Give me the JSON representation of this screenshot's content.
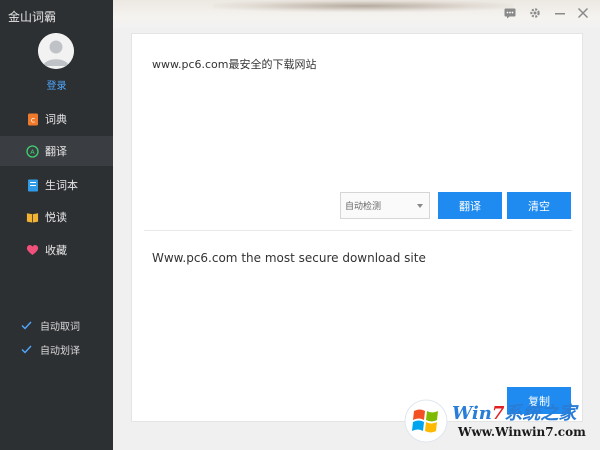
{
  "app": {
    "title": "金山词霸"
  },
  "user": {
    "login_label": "登录"
  },
  "nav": {
    "items": [
      {
        "label": "词典",
        "icon": "dictionary-icon"
      },
      {
        "label": "翻译",
        "icon": "translate-icon",
        "active": true
      },
      {
        "label": "生词本",
        "icon": "wordbook-icon"
      },
      {
        "label": "悦读",
        "icon": "reading-icon"
      },
      {
        "label": "收藏",
        "icon": "heart-icon"
      }
    ]
  },
  "options": [
    {
      "label": "自动取词",
      "checked": true
    },
    {
      "label": "自动划译",
      "checked": true
    }
  ],
  "window_controls": [
    "message-icon",
    "gear-icon",
    "minimize-icon",
    "close-icon"
  ],
  "translate": {
    "source_text": "www.pc6.com最安全的下载网站",
    "language": "自动检测",
    "translate_label": "翻译",
    "clear_label": "清空",
    "result_text": "Www.pc6.com the most secure download site",
    "copy_label": "复制"
  },
  "watermark": {
    "brand_prefix": "Win",
    "brand_seven": "7",
    "brand_suffix": "系统之家",
    "url": "Www.Winwin7.com"
  },
  "colors": {
    "accent": "#1f8bf0",
    "sidebar": "#2d3033",
    "link": "#4ea8ff"
  }
}
